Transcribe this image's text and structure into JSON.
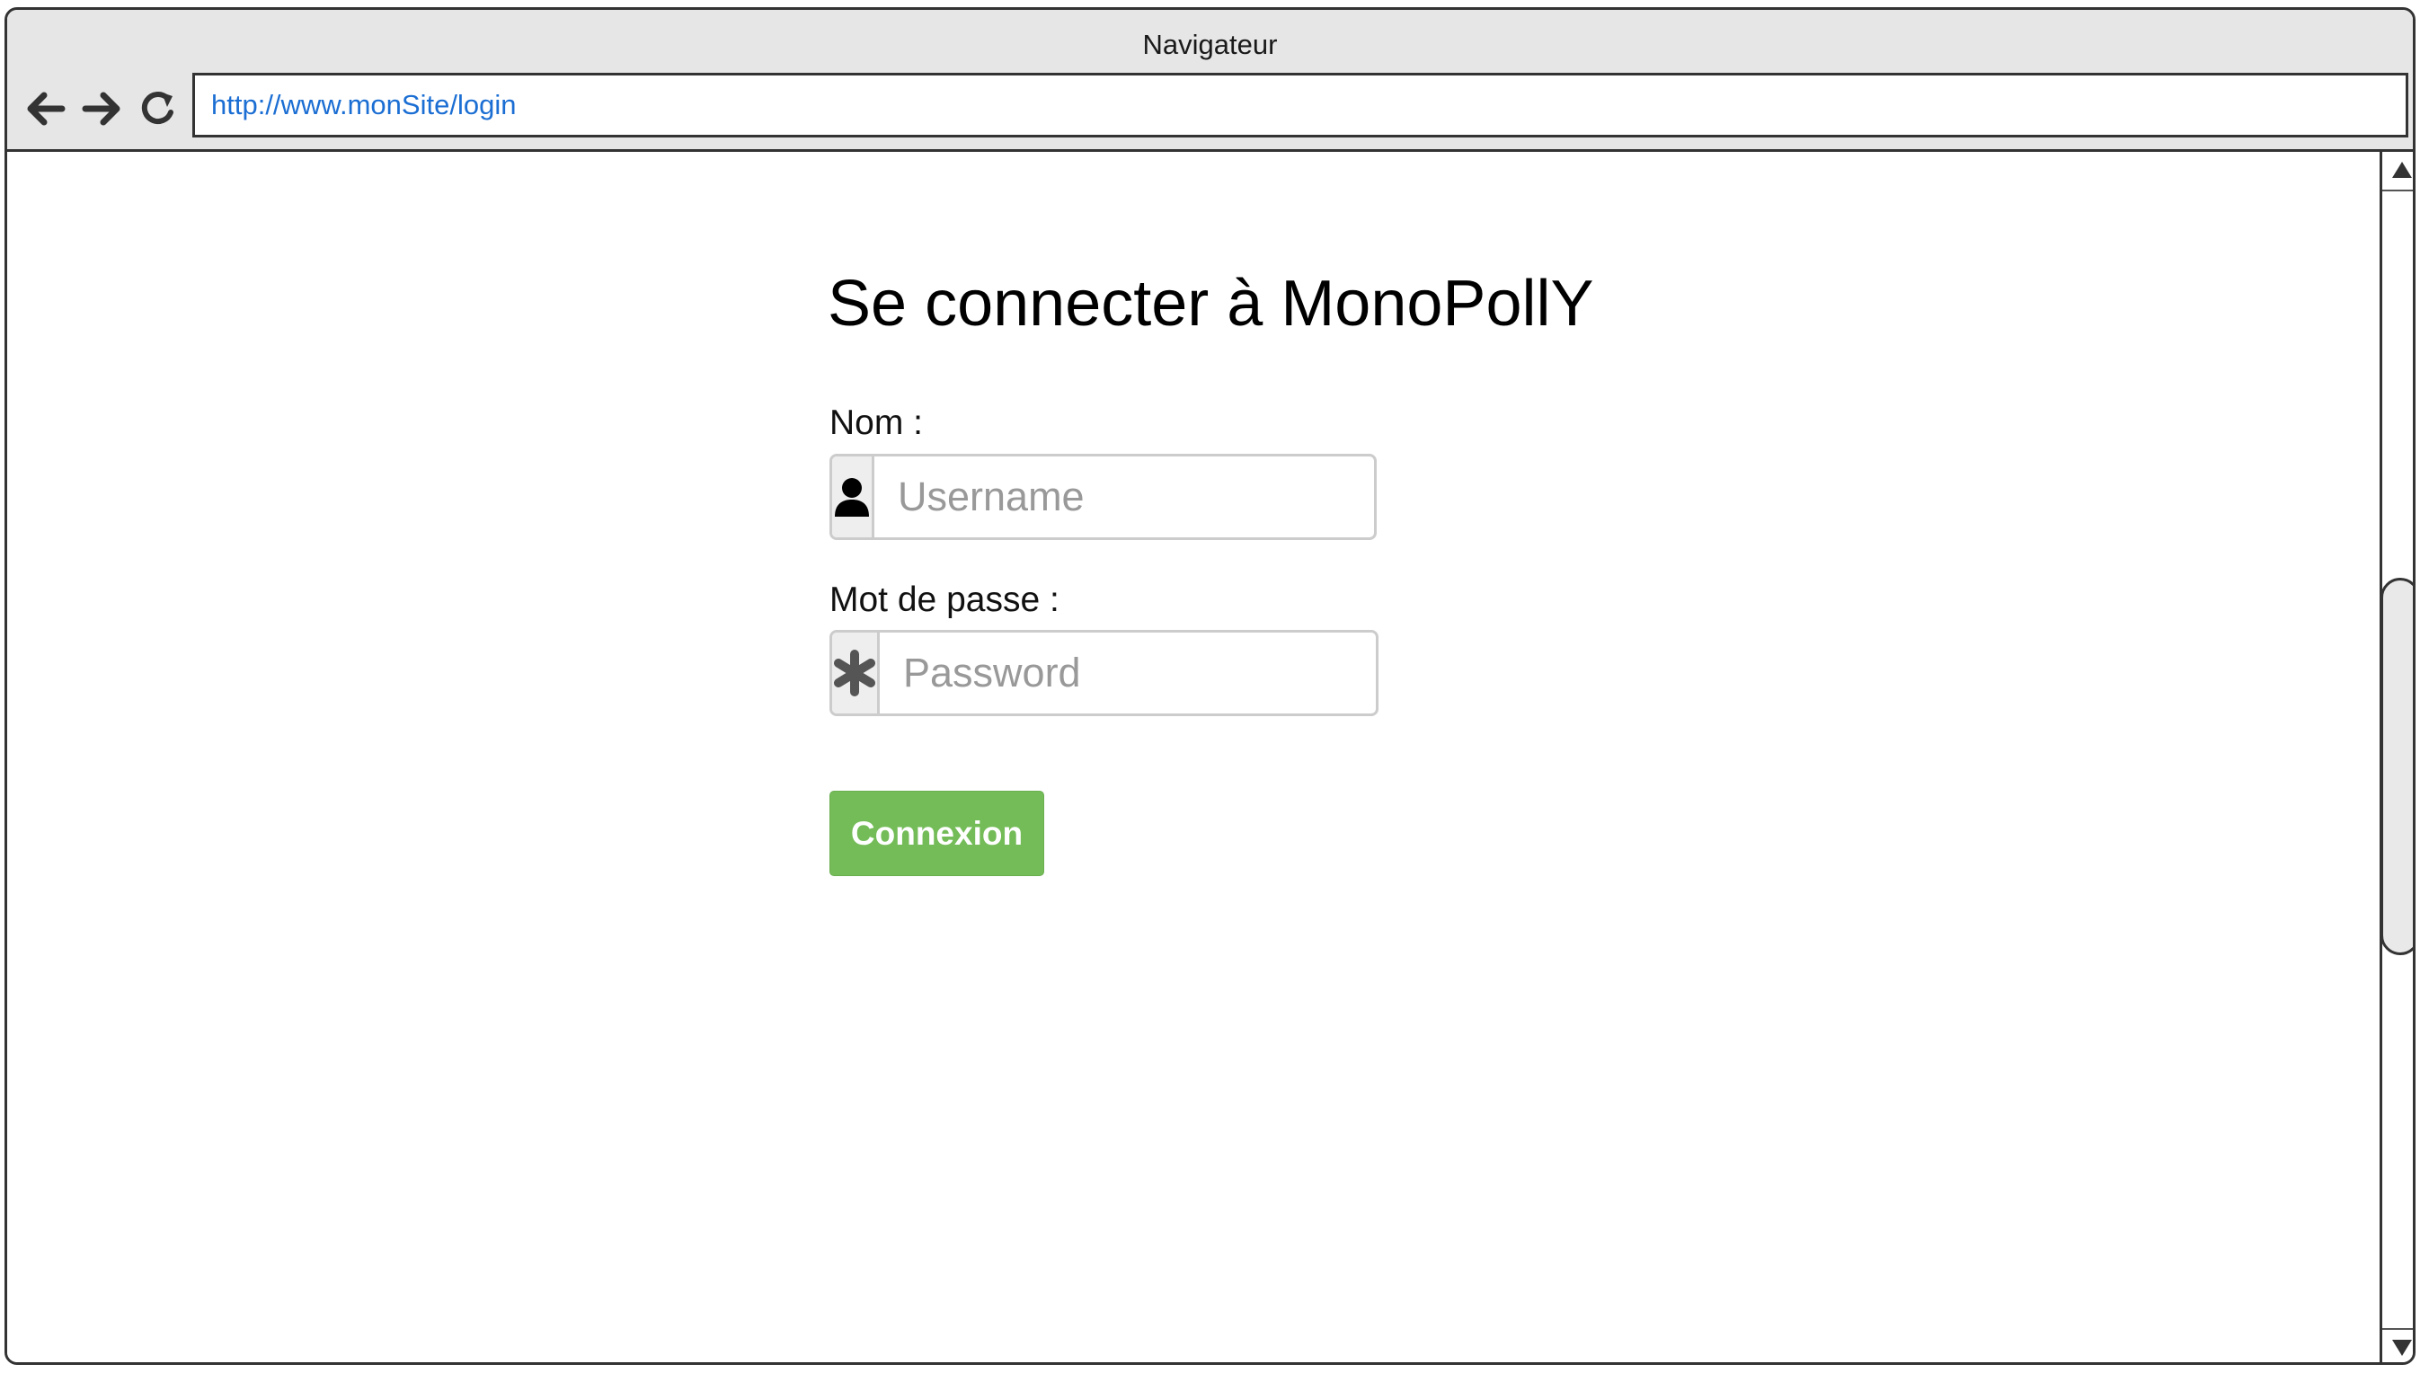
{
  "window": {
    "title": "Navigateur"
  },
  "toolbar": {
    "back_icon": "arrow-left-icon",
    "forward_icon": "arrow-right-icon",
    "reload_icon": "reload-icon",
    "url": "http://www.monSite/login"
  },
  "login": {
    "title": "Se connecter à MonoPollY",
    "username": {
      "label": "Nom :",
      "placeholder": "Username",
      "value": "",
      "icon": "user-icon"
    },
    "password": {
      "label": "Mot de passe :",
      "placeholder": "Password",
      "value": "",
      "icon": "asterisk-icon"
    },
    "submit_label": "Connexion"
  },
  "colors": {
    "url_text": "#1b6ed3",
    "button_bg": "#74bc58",
    "chrome_bg": "#e6e6e6"
  }
}
